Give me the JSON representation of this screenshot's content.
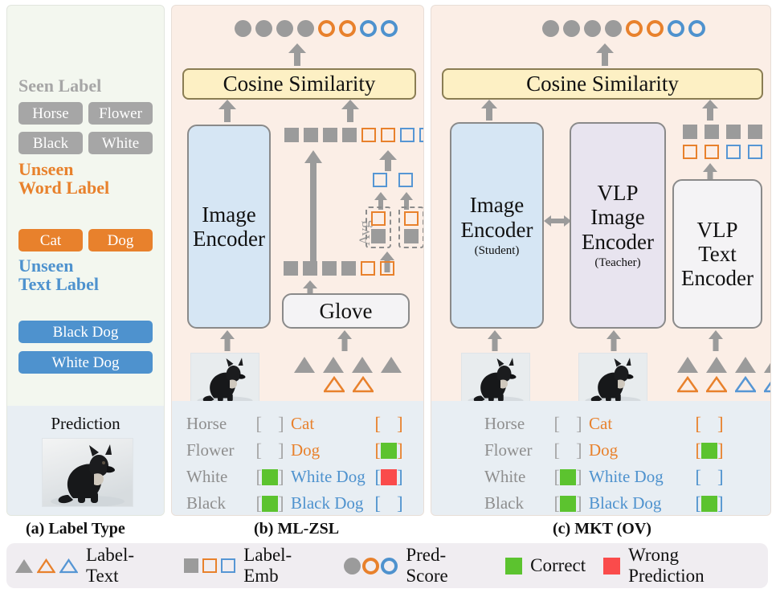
{
  "figure": {
    "caption_a": "(a) Label Type",
    "caption_b": "(b) ML-ZSL",
    "caption_c": "(c) MKT (OV)"
  },
  "panel_a": {
    "groups": [
      {
        "title": "Seen Label",
        "color": "#a6a6a6",
        "style": "gray",
        "chips": [
          "Horse",
          "Flower",
          "Black",
          "White"
        ]
      },
      {
        "title": "Unseen Word Label",
        "color": "#e8812c",
        "style": "orange",
        "chips": [
          "Cat",
          "Dog"
        ]
      },
      {
        "title": "Unseen Text Label",
        "color": "#4e92ce",
        "style": "blue",
        "chips": [
          "Black Dog",
          "White Dog"
        ]
      }
    ],
    "seen_title": "Seen Label",
    "unseen_word_title_l1": "Unseen",
    "unseen_word_title_l2": "Word Label",
    "unseen_text_title_l1": "Unseen",
    "unseen_text_title_l2": "Text Label",
    "chip_horse": "Horse",
    "chip_flower": "Flower",
    "chip_black": "Black",
    "chip_white": "White",
    "chip_cat": "Cat",
    "chip_dog": "Dog",
    "chip_black_dog": "Black Dog",
    "chip_white_dog": "White Dog",
    "prediction_label": "Prediction",
    "prediction_image_alt": "black-dog-in-snow-photo"
  },
  "panel_b": {
    "cosine_label": "Cosine Similarity",
    "image_encoder_line1": "Image",
    "image_encoder_line2": "Encoder",
    "glove_label": "Glove",
    "avg_label": "Avg",
    "image_alt": "black-dog-in-snow-photo",
    "pred_scores": [
      "gray",
      "gray",
      "gray",
      "gray",
      "orange",
      "orange",
      "blue",
      "blue"
    ],
    "label_emb_top": [
      "gray",
      "gray",
      "gray",
      "gray",
      "orange",
      "orange",
      "blue",
      "blue"
    ],
    "label_emb_mid": [
      "blue",
      "blue"
    ],
    "label_emb_glove": [
      "gray",
      "gray",
      "gray",
      "gray",
      "orange",
      "orange"
    ],
    "avg_pairs": [
      [
        "orange",
        "gray"
      ],
      [
        "orange",
        "gray"
      ]
    ],
    "label_text_filled": 4,
    "label_text_outline": [
      "orange",
      "orange"
    ],
    "results": [
      {
        "name": "Horse",
        "name_color": "gray",
        "mark": "none",
        "text": "Cat",
        "text_color": "orange",
        "text_mark": "none"
      },
      {
        "name": "Flower",
        "name_color": "gray",
        "mark": "none",
        "text": "Dog",
        "text_color": "orange",
        "text_mark": "green"
      },
      {
        "name": "White",
        "name_color": "gray",
        "mark": "green",
        "text": "White Dog",
        "text_color": "blue",
        "text_mark": "red"
      },
      {
        "name": "Black",
        "name_color": "gray",
        "mark": "green",
        "text": "Black Dog",
        "text_color": "blue",
        "text_mark": "none"
      }
    ]
  },
  "panel_c": {
    "cosine_label": "Cosine Similarity",
    "image_encoder_line1": "Image",
    "image_encoder_line2": "Encoder",
    "image_encoder_sub": "(Student)",
    "vlp_image_encoder_line1": "VLP",
    "vlp_image_encoder_line2": "Image",
    "vlp_image_encoder_line3": "Encoder",
    "vlp_image_encoder_sub": "(Teacher)",
    "vlp_text_encoder_line1": "VLP",
    "vlp_text_encoder_line2": "Text",
    "vlp_text_encoder_line3": "Encoder",
    "image_alt_student": "black-dog-in-snow-photo",
    "image_alt_teacher": "black-dog-in-snow-photo",
    "pred_scores": [
      "gray",
      "gray",
      "gray",
      "gray",
      "orange",
      "orange",
      "blue",
      "blue"
    ],
    "label_emb_top": [
      "gray",
      "gray",
      "gray",
      "gray"
    ],
    "label_emb_bottom": [
      "orange",
      "orange",
      "blue",
      "blue"
    ],
    "label_text_filled": 4,
    "label_text_outline": [
      "orange",
      "orange",
      "blue",
      "blue"
    ],
    "results": [
      {
        "name": "Horse",
        "name_color": "gray",
        "mark": "none",
        "text": "Cat",
        "text_color": "orange",
        "text_mark": "none"
      },
      {
        "name": "Flower",
        "name_color": "gray",
        "mark": "none",
        "text": "Dog",
        "text_color": "orange",
        "text_mark": "green"
      },
      {
        "name": "White",
        "name_color": "gray",
        "mark": "green",
        "text": "White Dog",
        "text_color": "blue",
        "text_mark": "none"
      },
      {
        "name": "Black",
        "name_color": "gray",
        "mark": "green",
        "text": "Black Dog",
        "text_color": "blue",
        "text_mark": "green"
      }
    ]
  },
  "legend": {
    "items": [
      {
        "label": "Label-Text",
        "glyph": "triangles"
      },
      {
        "label": "Label-Emb",
        "glyph": "squares"
      },
      {
        "label": "Pred-Score",
        "glyph": "circles"
      },
      {
        "label": "Correct",
        "glyph": "green-square"
      },
      {
        "label": "Wrong Prediction",
        "glyph": "red-square"
      }
    ],
    "label_text": "Label-Text",
    "label_emb": "Label-Emb",
    "pred_score": "Pred-Score",
    "correct": "Correct",
    "wrong": "Wrong Prediction"
  },
  "colors": {
    "gray": "#9b9b9b",
    "orange": "#e8812c",
    "blue": "#4e92ce",
    "green": "#5cc32f",
    "red": "#fa4b4b",
    "panel_a_bg": "#f3f7ef",
    "panel_bc_bg": "#fbeee6",
    "results_bg": "#e8eef3",
    "cosine_bg": "#fdf0c4",
    "legend_bg": "#f0edf1"
  }
}
